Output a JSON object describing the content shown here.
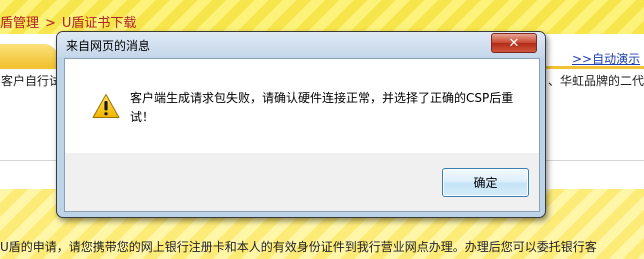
{
  "background": {
    "breadcrumb": {
      "section": "盾管理",
      "separator": ">",
      "current": "U盾证书下载"
    },
    "auto_demo_link": ">>自动演示",
    "left_text": "客户自行试",
    "right_text": "、华虹品牌的二代",
    "footer_text": "U盾的申请，请您携带您的网上银行注册卡和本人的有效身份证件到我行营业网点办理。办理后您可以委托银行客"
  },
  "dialog": {
    "title": "来自网页的消息",
    "icon": "warning-icon",
    "message": "客户端生成请求包失败，请确认硬件连接正常，并选择了正确的CSP后重试！",
    "ok_label": "确定",
    "close_icon": "close-icon"
  },
  "colors": {
    "header_yellow": "#fdf27a",
    "breadcrumb_red": "#b22222",
    "link_blue": "#1f3fae",
    "close_red": "#c8452e",
    "warning_yellow": "#f5c400"
  }
}
